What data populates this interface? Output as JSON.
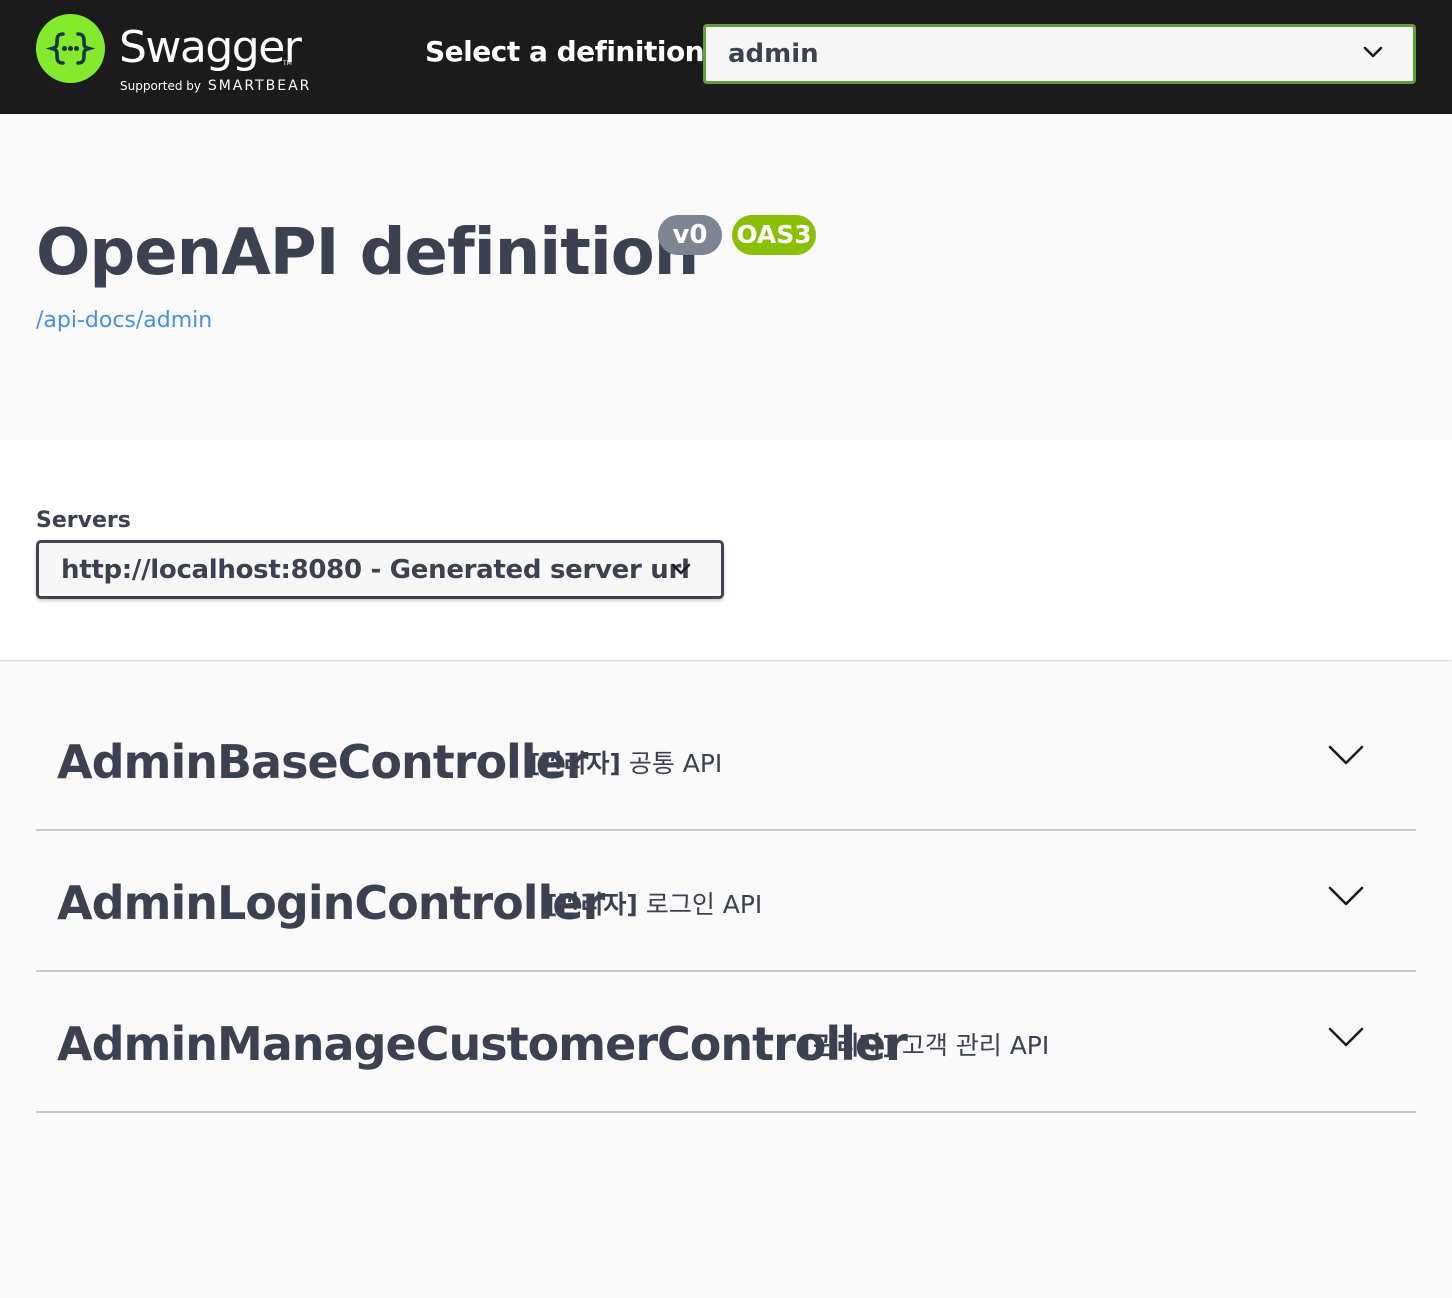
{
  "topbar": {
    "brand": "Swagger",
    "brand_sub": "Supported by",
    "brand_company": "SMARTBEAR",
    "select_label": "Select a definition",
    "definition_value": "admin"
  },
  "info": {
    "title": "OpenAPI definition",
    "version": "v0",
    "oas_badge": "OAS3",
    "spec_url": "/api-docs/admin"
  },
  "servers": {
    "label": "Servers",
    "selected": "http://localhost:8080 - Generated server url"
  },
  "tags": [
    {
      "name": "AdminBaseController",
      "desc_prefix": "[관리자]",
      "desc": "공통 API"
    },
    {
      "name": "AdminLoginController",
      "desc_prefix": "[관리자]",
      "desc": "로그인 API"
    },
    {
      "name": "AdminManageCustomerController",
      "desc_prefix": "[관리자]",
      "desc": "고객 관리 API"
    }
  ],
  "colors": {
    "topbar_bg": "#1b1b1b",
    "logo_green": "#85ea2d",
    "select_border": "#62a03f",
    "version_badge": "#7d8492",
    "oas_badge": "#89bf04",
    "link": "#4990e2",
    "text": "#3b4151"
  }
}
